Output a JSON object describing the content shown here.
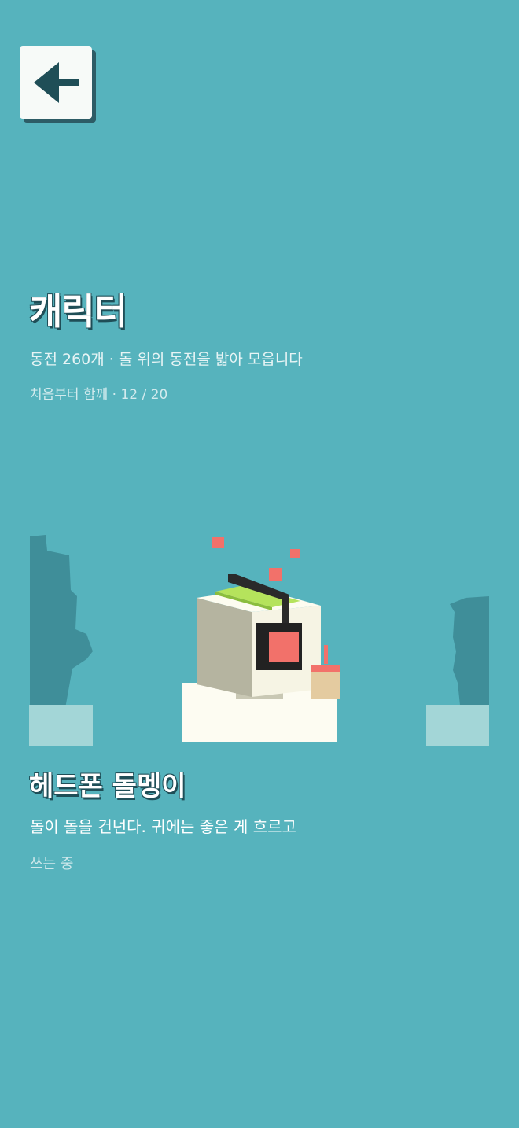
{
  "header": {
    "back_icon": "arrow-left-icon",
    "title": "캐릭터",
    "coins_text": "동전 260개 · 돌 위의 동전을 밟아 모읍니다",
    "progress_text": "처음부터 함께 · 12 / 20"
  },
  "character": {
    "name": "헤드폰 돌멩이",
    "description": "돌이 돌을 건넌다. 귀에는 좋은 게 흐르고",
    "status": "쓰는 중"
  },
  "colors": {
    "background": "#56b3bd",
    "accent_dark": "#1f4e57",
    "silhouette": "#3f8e99",
    "stone_white": "#f8f7ea",
    "headphone_red": "#f2716a",
    "leaf_green": "#b5e35c"
  }
}
